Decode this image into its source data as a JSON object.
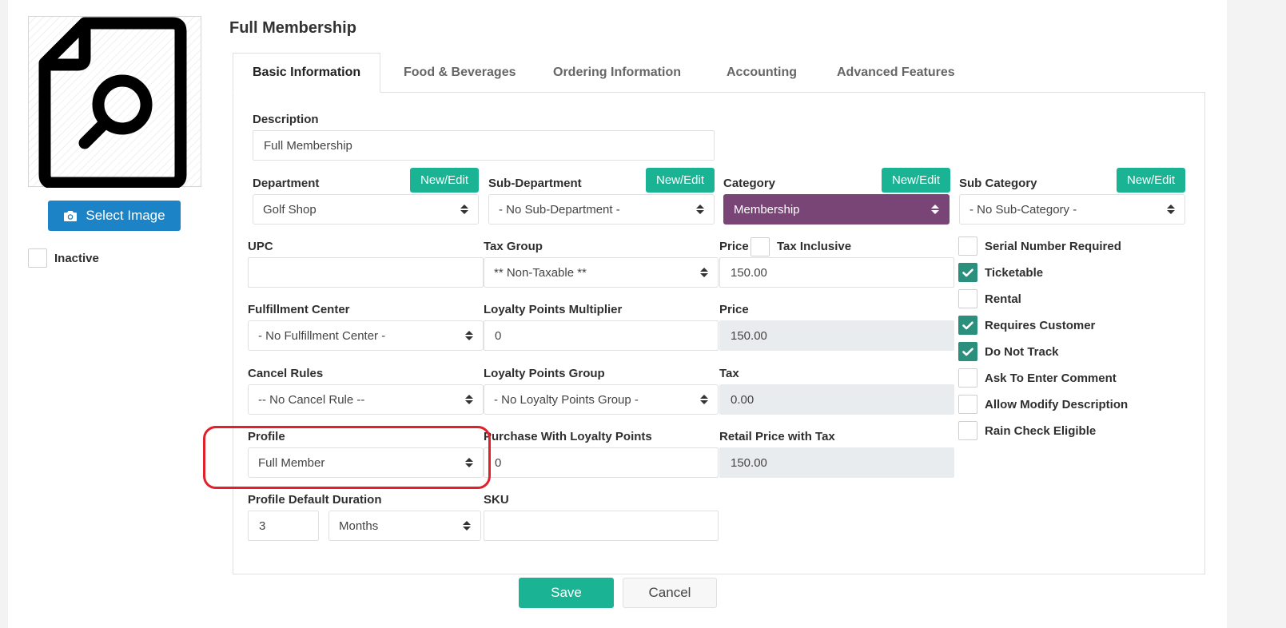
{
  "sidebar": {
    "image_placeholder_icon": "document-search-icon",
    "select_image_label": "Select Image",
    "inactive_label": "Inactive",
    "inactive_checked": false
  },
  "header": {
    "title": "Full Membership"
  },
  "tabs": [
    {
      "label": "Basic Information",
      "active": true
    },
    {
      "label": "Food & Beverages",
      "active": false
    },
    {
      "label": "Ordering Information",
      "active": false
    },
    {
      "label": "Accounting",
      "active": false
    },
    {
      "label": "Advanced Features",
      "active": false
    }
  ],
  "form": {
    "description": {
      "label": "Description",
      "value": "Full Membership"
    },
    "new_edit_label": "New/Edit",
    "department": {
      "label": "Department",
      "value": "Golf Shop"
    },
    "sub_department": {
      "label": "Sub-Department",
      "value": "- No Sub-Department -"
    },
    "category": {
      "label": "Category",
      "value": "Membership",
      "color": "#794577"
    },
    "sub_category": {
      "label": "Sub Category",
      "value": "- No Sub-Category -"
    },
    "upc": {
      "label": "UPC",
      "value": ""
    },
    "tax_group": {
      "label": "Tax Group",
      "value": "** Non-Taxable **"
    },
    "price": {
      "label": "Price",
      "value": "150.00"
    },
    "tax_inclusive": {
      "label": "Tax Inclusive",
      "checked": false
    },
    "fulfillment_center": {
      "label": "Fulfillment Center",
      "value": "- No Fulfillment Center -"
    },
    "loyalty_multiplier": {
      "label": "Loyalty Points Multiplier",
      "value": "0"
    },
    "price2": {
      "label": "Price",
      "value": "150.00"
    },
    "cancel_rules": {
      "label": "Cancel Rules",
      "value": "-- No Cancel Rule --"
    },
    "loyalty_group": {
      "label": "Loyalty Points Group",
      "value": "- No Loyalty Points Group -"
    },
    "tax": {
      "label": "Tax",
      "value": "0.00"
    },
    "profile": {
      "label": "Profile",
      "value": "Full Member"
    },
    "purchase_loyalty": {
      "label": "Purchase With Loyalty Points",
      "value": "0"
    },
    "retail_price_tax": {
      "label": "Retail Price with Tax",
      "value": "150.00"
    },
    "profile_duration": {
      "label": "Profile Default Duration",
      "value": "3",
      "unit": "Months"
    },
    "sku": {
      "label": "SKU",
      "value": ""
    }
  },
  "flags": [
    {
      "label": "Serial Number Required",
      "checked": false
    },
    {
      "label": "Ticketable",
      "checked": true
    },
    {
      "label": "Rental",
      "checked": false
    },
    {
      "label": "Requires Customer",
      "checked": true
    },
    {
      "label": "Do Not Track",
      "checked": true
    },
    {
      "label": "Ask To Enter Comment",
      "checked": false
    },
    {
      "label": "Allow Modify Description",
      "checked": false
    },
    {
      "label": "Rain Check Eligible",
      "checked": false
    }
  ],
  "actions": {
    "save_label": "Save",
    "cancel_label": "Cancel"
  },
  "colors": {
    "primary": "#1ab394",
    "blue": "#1c84c6",
    "check": "#2a8f7c",
    "highlight": "#e0202a"
  }
}
